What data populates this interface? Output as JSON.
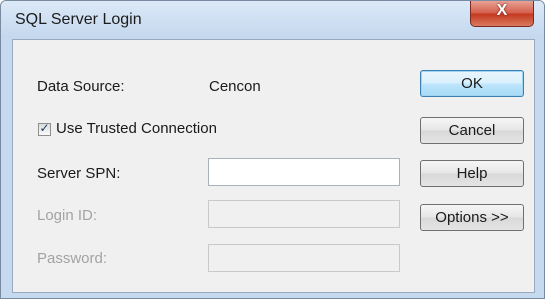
{
  "window": {
    "title": "SQL Server Login",
    "close_glyph": "X"
  },
  "form": {
    "data_source_label": "Data Source:",
    "data_source_value": "Cencon",
    "trusted_connection_label": "Use Trusted Connection",
    "trusted_connection_checked": true,
    "server_spn_label": "Server SPN:",
    "server_spn_value": "",
    "login_id_label": "Login ID:",
    "login_id_value": "",
    "password_label": "Password:",
    "password_value": ""
  },
  "buttons": {
    "ok": "OK",
    "cancel": "Cancel",
    "help": "Help",
    "options": "Options >>"
  },
  "colors": {
    "title_bar": "#c3d7ee",
    "client_bg": "#f0f0f0",
    "close_button": "#c4381f",
    "default_button": "#bee6fd",
    "disabled_text": "#a3a3a3"
  }
}
